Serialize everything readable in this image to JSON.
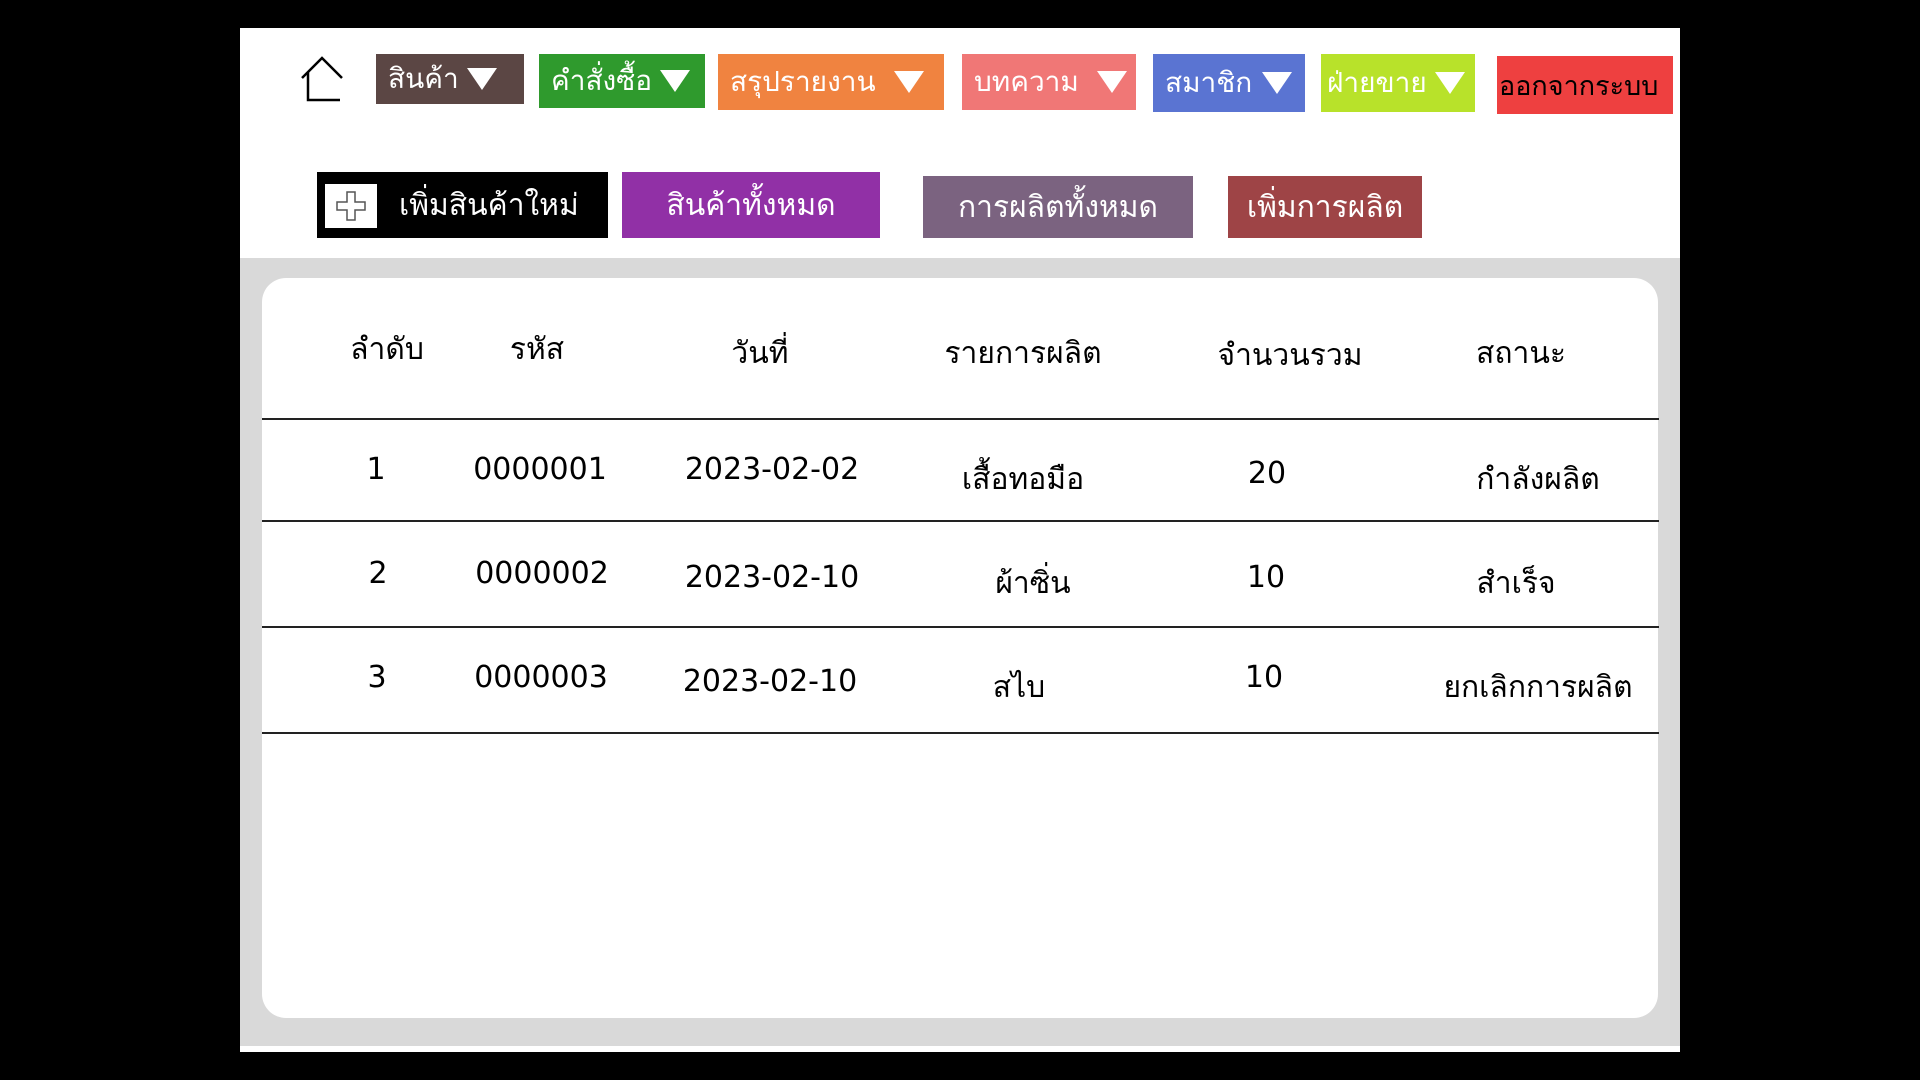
{
  "nav": {
    "items": [
      {
        "label": "สินค้า",
        "color": "#5b4644"
      },
      {
        "label": "คำสั่งซื้อ",
        "color": "#2f9a2d"
      },
      {
        "label": "สรุปรายงาน",
        "color": "#f08340"
      },
      {
        "label": "บทความ",
        "color": "#f07776"
      },
      {
        "label": "สมาชิก",
        "color": "#5a74d2"
      },
      {
        "label": "ฝ่ายขาย",
        "color": "#b8e22a"
      }
    ],
    "logout": {
      "label": "ออกจากระบบ",
      "color": "#ee4040"
    }
  },
  "subnav": {
    "add_product": "เพิ่มสินค้าใหม่",
    "all_products": "สินค้าทั้งหมด",
    "all_production": "การผลิตทั้งหมด",
    "add_production": "เพิ่มการผลิต"
  },
  "table": {
    "headers": [
      "ลำดับ",
      "รหัส",
      "วันที่",
      "รายการผลิต",
      "จำนวนรวม",
      "สถานะ"
    ],
    "rows": [
      [
        "1",
        "0000001",
        "2023-02-02",
        "เสื้อทอมือ",
        "20",
        "กำลังผลิต"
      ],
      [
        "2",
        "0000002",
        "2023-02-10",
        "ผ้าซิ่น",
        "10",
        "สำเร็จ"
      ],
      [
        "3",
        "0000003",
        "2023-02-10",
        "สไบ",
        "10",
        "ยกเลิกการผลิต"
      ]
    ]
  }
}
